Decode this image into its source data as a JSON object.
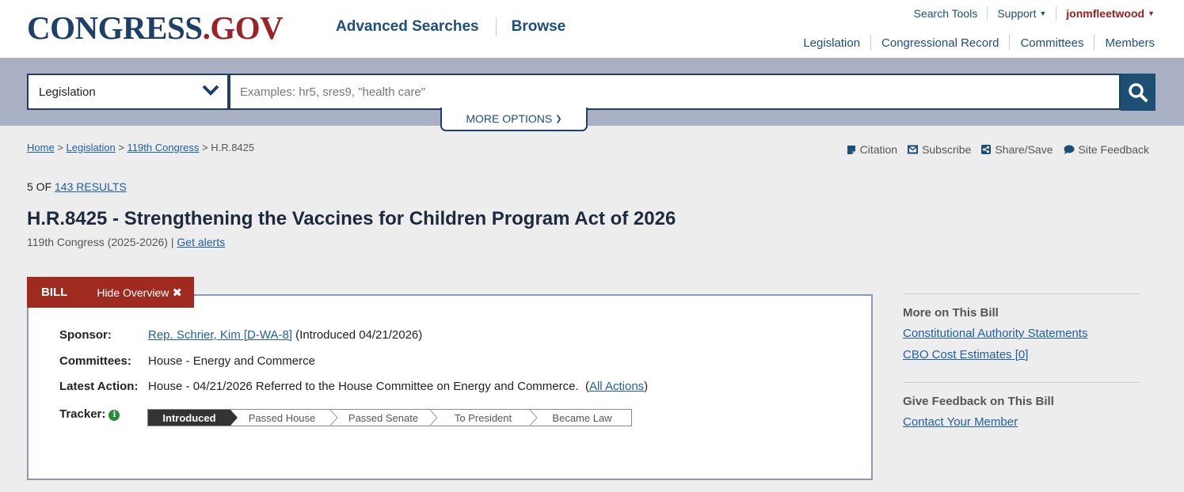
{
  "logo": {
    "part1": "CONGRESS",
    "part2": ".GOV"
  },
  "main_nav": {
    "advanced": "Advanced Searches",
    "browse": "Browse"
  },
  "utility": {
    "search_tools": "Search Tools",
    "support": "Support",
    "user": "jonmfleetwood"
  },
  "secondary_nav": [
    "Legislation",
    "Congressional Record",
    "Committees",
    "Members"
  ],
  "search": {
    "selected_collection": "Legislation",
    "placeholder": "Examples: hr5, sres9, \"health care\"",
    "more_options": "MORE OPTIONS"
  },
  "breadcrumb": {
    "home": "Home",
    "legislation": "Legislation",
    "congress": "119th Congress",
    "current": "H.R.8425",
    "sep": ">"
  },
  "tools": {
    "citation": "Citation",
    "subscribe": "Subscribe",
    "share": "Share/Save",
    "feedback": "Site Feedback"
  },
  "results": {
    "prefix": "5 OF",
    "link": "143 RESULTS"
  },
  "bill": {
    "title": "H.R.8425 - Strengthening the Vaccines for Children Program Act of 2026",
    "congress": "119th Congress (2025-2026)",
    "get_alerts": "Get alerts",
    "tab_label": "BILL",
    "hide_overview": "Hide Overview",
    "sponsor_label": "Sponsor:",
    "sponsor_link": "Rep. Schrier, Kim [D-WA-8]",
    "sponsor_intro": "(Introduced 04/21/2026)",
    "committees_label": "Committees:",
    "committees_value": "House - Energy and Commerce",
    "latest_action_label": "Latest Action:",
    "latest_action_value": "House - 04/21/2026 Referred to the House Committee on Energy and Commerce.",
    "all_actions": "All Actions",
    "tracker_label": "Tracker:",
    "tracker_steps": [
      "Introduced",
      "Passed House",
      "Passed Senate",
      "To President",
      "Became Law"
    ],
    "tracker_current_index": 0
  },
  "sidebar": {
    "more_heading": "More on This Bill",
    "constitutional": "Constitutional Authority Statements",
    "cbo": "CBO Cost Estimates [0]",
    "feedback_heading": "Give Feedback on This Bill",
    "contact": "Contact Your Member"
  },
  "colors": {
    "brand_navy": "#1d3f68",
    "brand_red": "#9b2226",
    "bill_tab": "#9e2a20",
    "link": "#1f5fa8"
  }
}
